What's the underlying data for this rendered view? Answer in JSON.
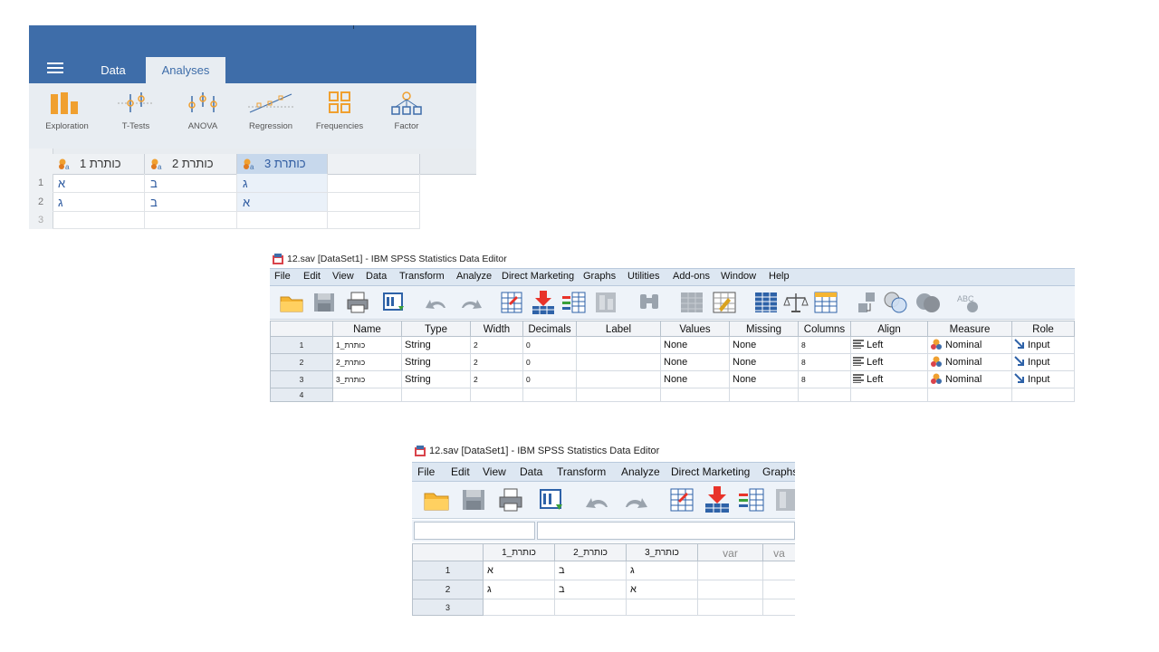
{
  "jamovi": {
    "tabs": [
      "Data",
      "Analyses"
    ],
    "ribbon": [
      {
        "label": "Exploration",
        "icon": "exploration-icon"
      },
      {
        "label": "T-Tests",
        "icon": "t-tests-icon"
      },
      {
        "label": "ANOVA",
        "icon": "anova-icon"
      },
      {
        "label": "Regression",
        "icon": "regression-icon"
      },
      {
        "label": "Frequencies",
        "icon": "frequencies-icon"
      },
      {
        "label": "Factor",
        "icon": "factor-icon"
      }
    ],
    "columns": [
      "כותרת 1",
      "כותרת 2",
      "כותרת 3"
    ],
    "row_numbers": [
      "1",
      "2",
      "3"
    ],
    "rows": [
      [
        "א",
        "ב",
        "ג"
      ],
      [
        "ג",
        "ב",
        "א"
      ],
      [
        "",
        "",
        ""
      ]
    ],
    "colors": {
      "header": "#3e6da9",
      "ribbon": "#e8edf2",
      "accent": "#f0a030",
      "text": "#2d5aa0"
    }
  },
  "spss_variable_view": {
    "title": "12.sav [DataSet1] - IBM SPSS Statistics Data Editor",
    "menu": [
      "File",
      "Edit",
      "View",
      "Data",
      "Transform",
      "Analyze",
      "Direct Marketing",
      "Graphs",
      "Utilities",
      "Add-ons",
      "Window",
      "Help"
    ],
    "columns": [
      "Name",
      "Type",
      "Width",
      "Decimals",
      "Label",
      "Values",
      "Missing",
      "Columns",
      "Align",
      "Measure",
      "Role"
    ],
    "row_numbers": [
      "1",
      "2",
      "3",
      "4"
    ],
    "rows": [
      [
        "כותרת_1",
        "String",
        "2",
        "0",
        "",
        "None",
        "None",
        "8",
        "Left",
        "Nominal",
        "Input"
      ],
      [
        "כותרת_2",
        "String",
        "2",
        "0",
        "",
        "None",
        "None",
        "8",
        "Left",
        "Nominal",
        "Input"
      ],
      [
        "כותרת_3",
        "String",
        "2",
        "0",
        "",
        "None",
        "None",
        "8",
        "Left",
        "Nominal",
        "Input"
      ]
    ]
  },
  "spss_data_view": {
    "title": "12.sav [DataSet1] - IBM SPSS Statistics Data Editor",
    "menu": [
      "File",
      "Edit",
      "View",
      "Data",
      "Transform",
      "Analyze",
      "Direct Marketing",
      "Graphs"
    ],
    "columns": [
      "כותרת_1",
      "כותרת_2",
      "כותרת_3",
      "var",
      "va"
    ],
    "row_numbers": [
      "1",
      "2",
      "3"
    ],
    "rows": [
      [
        "א",
        "ב",
        "ג"
      ],
      [
        "ג",
        "ב",
        "א"
      ]
    ]
  }
}
